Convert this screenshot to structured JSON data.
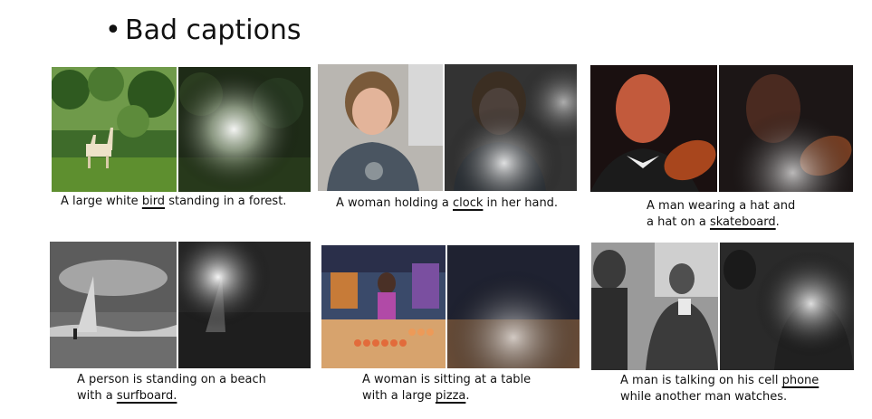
{
  "title": {
    "bullet": "•",
    "text": "Bad captions"
  },
  "panels": [
    {
      "name": "giraffe",
      "caption": {
        "line1_pre": "A large white ",
        "line1_word": "bird",
        "line1_post": " standing in a forest."
      }
    },
    {
      "name": "woman-clock",
      "caption": {
        "line1_pre": "A woman holding a ",
        "line1_word": "clock",
        "line1_post": " in her hand."
      }
    },
    {
      "name": "violinist",
      "caption": {
        "line1": "A man wearing a hat and",
        "line2_pre": "a hat on a ",
        "line2_word": "skateboard",
        "line2_post": "."
      }
    },
    {
      "name": "windsurfer",
      "caption": {
        "line1": "A person is standing on a beach",
        "line2_pre": "with a ",
        "line2_word": "surfboard.",
        "line2_post": ""
      }
    },
    {
      "name": "market",
      "caption": {
        "line1": "A woman is sitting at a table",
        "line2_pre": "with a large ",
        "line2_word": "pizza",
        "line2_post": "."
      }
    },
    {
      "name": "phone",
      "caption": {
        "line1_pre": "A man is talking on his cell ",
        "line1_word": "phone",
        "line1_post": "",
        "line2": "while another man watches."
      }
    }
  ]
}
